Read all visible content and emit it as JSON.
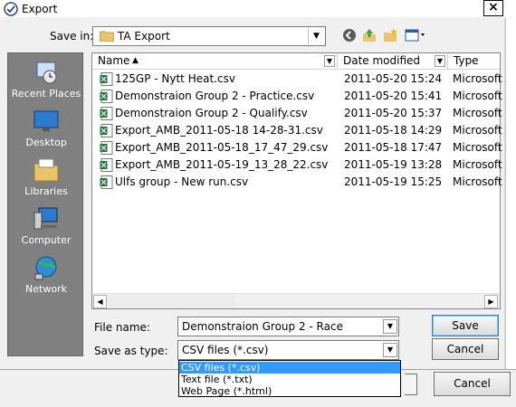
{
  "window": {
    "title": "Export",
    "close_label": "×"
  },
  "save_in": {
    "label": "Save in:",
    "value": "TA Export"
  },
  "toolbar": {
    "icons": [
      "back-icon",
      "up-folder-icon",
      "new-folder-icon",
      "views-menu-icon"
    ]
  },
  "places": [
    {
      "label": "Recent Places",
      "icon": "recent-places-icon"
    },
    {
      "label": "Desktop",
      "icon": "desktop-icon"
    },
    {
      "label": "Libraries",
      "icon": "libraries-icon"
    },
    {
      "label": "Computer",
      "icon": "computer-icon"
    },
    {
      "label": "Network",
      "icon": "network-icon"
    }
  ],
  "columns": {
    "name": "Name",
    "date": "Date modified",
    "type": "Type"
  },
  "files": [
    {
      "name": "125GP - Nytt Heat.csv",
      "date": "2011-05-20 15:24",
      "type": "Microsoft"
    },
    {
      "name": "Demonstraion Group 2 - Practice.csv",
      "date": "2011-05-20 15:41",
      "type": "Microsoft"
    },
    {
      "name": "Demonstraion Group 2 - Qualify.csv",
      "date": "2011-05-20 15:37",
      "type": "Microsoft"
    },
    {
      "name": "Export_AMB_2011-05-18 14-28-31.csv",
      "date": "2011-05-18 14:29",
      "type": "Microsoft"
    },
    {
      "name": "Export_AMB_2011-05-18_17_47_29.csv",
      "date": "2011-05-18 17:47",
      "type": "Microsoft"
    },
    {
      "name": "Export_AMB_2011-05-19_13_28_22.csv",
      "date": "2011-05-19 13:28",
      "type": "Microsoft"
    },
    {
      "name": "Ulfs group - New run.csv",
      "date": "2011-05-19 15:25",
      "type": "Microsoft"
    }
  ],
  "file_name": {
    "label": "File name:",
    "value": "Demonstraion Group 2 - Race"
  },
  "save_type": {
    "label": "Save as type:",
    "value": "CSV files (*.csv)",
    "options": [
      "CSV files (*.csv)",
      "Text file (*.txt)",
      "Web Page (*.html)"
    ],
    "selected_index": 0
  },
  "buttons": {
    "save": "Save",
    "cancel": "Cancel",
    "background_cancel": "Cancel"
  },
  "colors": {
    "accent": "#3399ff",
    "places_bg": "#808080",
    "excel_green": "#1d7a3a"
  }
}
